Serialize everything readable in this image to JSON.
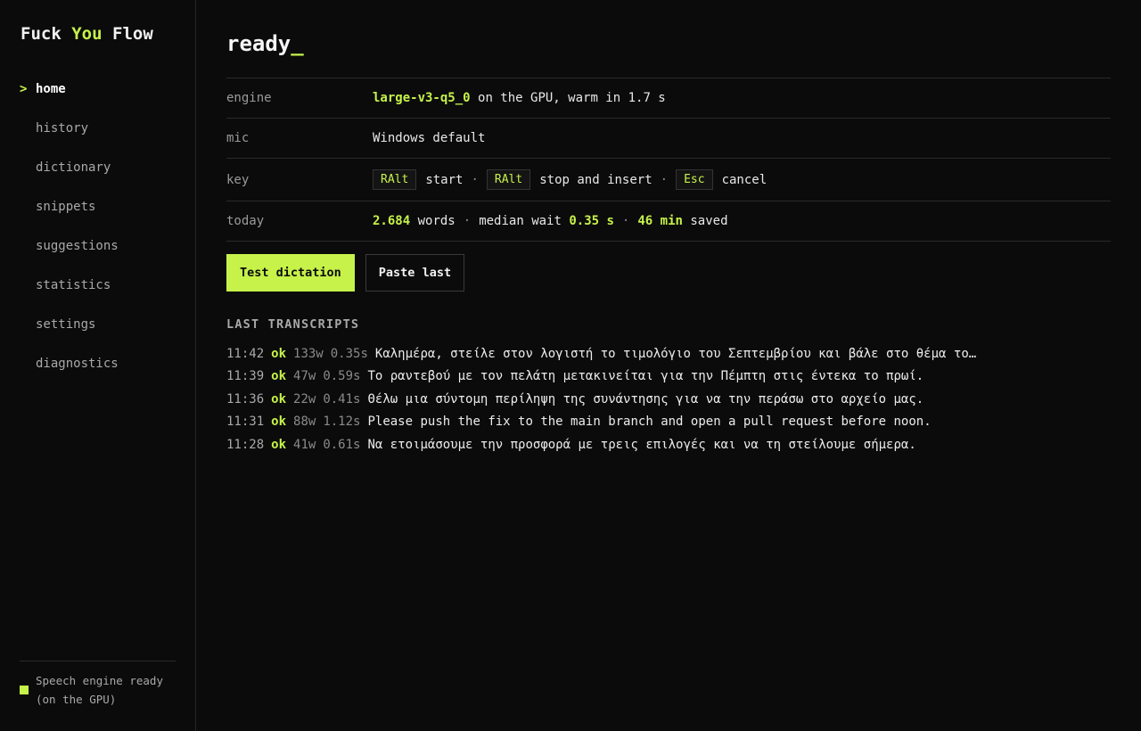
{
  "brand": {
    "part1": "Fuck",
    "part2": "You",
    "part3": "Flow"
  },
  "nav": {
    "active_marker": ">",
    "items": [
      {
        "label": "home"
      },
      {
        "label": "history"
      },
      {
        "label": "dictionary"
      },
      {
        "label": "snippets"
      },
      {
        "label": "suggestions"
      },
      {
        "label": "statistics"
      },
      {
        "label": "settings"
      },
      {
        "label": "diagnostics"
      }
    ]
  },
  "footer": {
    "status_line1": "Speech engine ready",
    "status_line2": "(on the GPU)"
  },
  "main": {
    "title": "ready",
    "title_cursor": "_",
    "info": {
      "engine": {
        "label": "engine",
        "model": "large-v3-q5_0",
        "rest": "on the GPU, warm in 1.7 s"
      },
      "mic": {
        "label": "mic",
        "value": "Windows default"
      },
      "key": {
        "label": "key",
        "start_key": "RAlt",
        "start_text": "start",
        "stop_key": "RAlt",
        "stop_text": "stop and insert",
        "cancel_key": "Esc",
        "cancel_text": "cancel",
        "sep": "·"
      },
      "today": {
        "label": "today",
        "words": "2.684",
        "words_text": "words",
        "wait_text": "median wait",
        "wait": "0.35 s",
        "saved": "46 min",
        "saved_text": "saved",
        "sep": "·"
      }
    },
    "buttons": {
      "test": "Test dictation",
      "paste": "Paste last"
    },
    "section_title": "LAST TRANSCRIPTS",
    "transcripts": [
      {
        "time": "11:42",
        "status": "ok",
        "words": "133w",
        "wait": "0.35s",
        "text": "Καλημέρα, στείλε στον λογιστή το τιμολόγιο του Σεπτεμβρίου και βάλε στο θέμα τον…"
      },
      {
        "time": "11:39",
        "status": "ok",
        "words": "47w",
        "wait": "0.59s",
        "text": "Το ραντεβού με τον πελάτη μετακινείται για την Πέμπτη στις έντεκα το πρωί."
      },
      {
        "time": "11:36",
        "status": "ok",
        "words": "22w",
        "wait": "0.41s",
        "text": "Θέλω μια σύντομη περίληψη της συνάντησης για να την περάσω στο αρχείο μας."
      },
      {
        "time": "11:31",
        "status": "ok",
        "words": "88w",
        "wait": "1.12s",
        "text": "Please push the fix to the main branch and open a pull request before noon."
      },
      {
        "time": "11:28",
        "status": "ok",
        "words": "41w",
        "wait": "0.61s",
        "text": "Να ετοιμάσουμε την προσφορά με τρεις επιλογές και να τη στείλουμε σήμερα."
      }
    ]
  },
  "colors": {
    "accent": "#c6f24a",
    "background": "#0b0b0b"
  }
}
